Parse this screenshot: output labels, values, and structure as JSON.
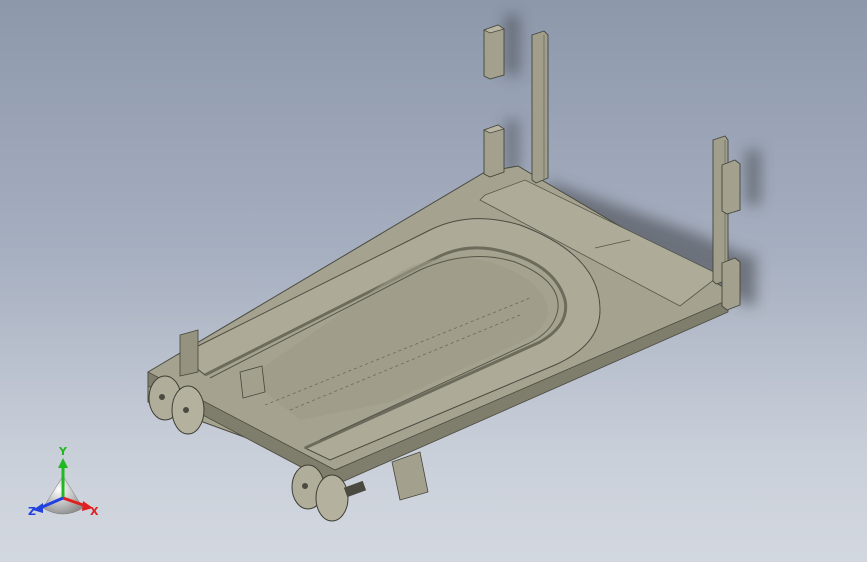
{
  "viewport": {
    "background_top": "#8d98ab",
    "background_bottom": "#d3d8e0",
    "model_color": "#a19f8c"
  },
  "triad": {
    "x_label": "X",
    "y_label": "Y",
    "z_label": "Z",
    "x_color": "#e02020",
    "y_color": "#22b822",
    "z_color": "#2040e0"
  }
}
